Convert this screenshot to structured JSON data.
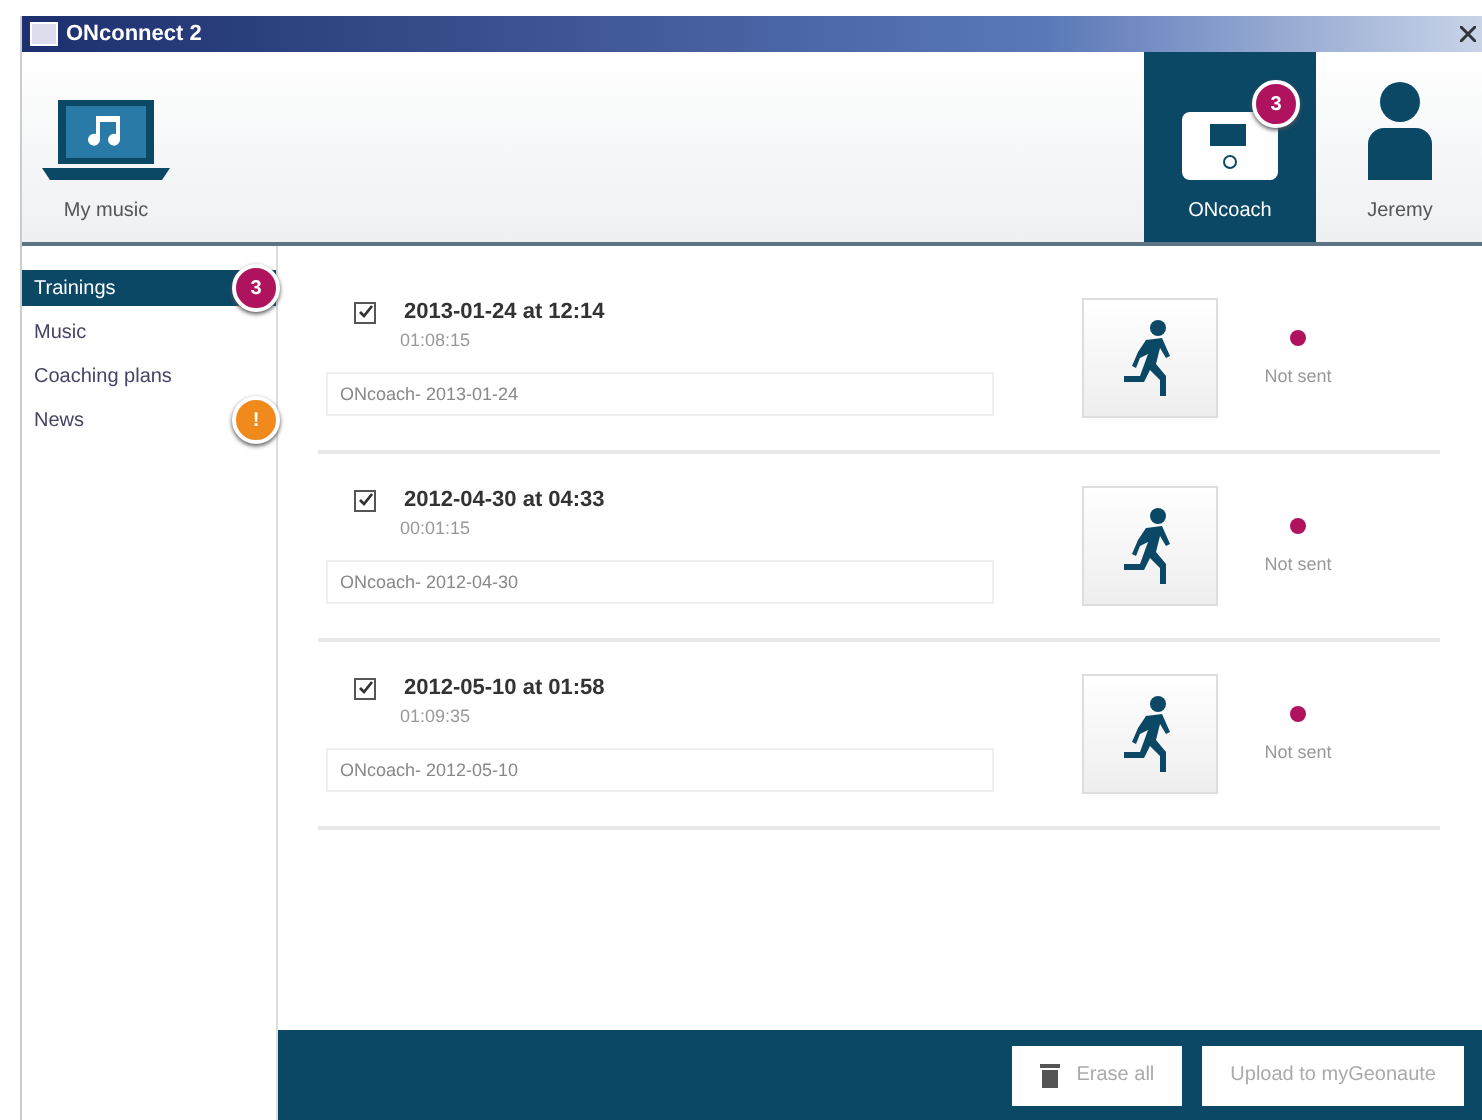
{
  "window": {
    "title": "ONconnect 2"
  },
  "header_tabs": [
    {
      "kind": "music",
      "label": "My music",
      "selected": false
    },
    {
      "kind": "device",
      "label": "ONcoach",
      "selected": true,
      "badge": "3"
    },
    {
      "kind": "user",
      "label": "Jeremy",
      "selected": false
    }
  ],
  "sidebar": {
    "items": [
      {
        "label": "Trainings",
        "selected": true,
        "badge": "3",
        "color": "#b0135e"
      },
      {
        "label": "Music",
        "selected": false
      },
      {
        "label": "Coaching plans",
        "selected": false
      },
      {
        "label": "News",
        "selected": false,
        "badge": "!",
        "color": "#f08a1c"
      }
    ]
  },
  "trainings": [
    {
      "checked": true,
      "title": "2013-01-24 at 12:14",
      "duration": "01:08:15",
      "name": "ONcoach- 2013-01-24",
      "status": "Not sent",
      "color": "#b0135e"
    },
    {
      "checked": true,
      "title": "2012-04-30 at 04:33",
      "duration": "00:01:15",
      "name": "ONcoach- 2012-04-30",
      "status": "Not sent",
      "color": "#b0135e"
    },
    {
      "checked": true,
      "title": "2012-05-10 at 01:58",
      "duration": "01:09:35",
      "name": "ONcoach- 2012-05-10",
      "status": "Not sent",
      "color": "#b0135e"
    }
  ],
  "footer": {
    "buttons": [
      {
        "kind": "erase",
        "label": "Erase all"
      },
      {
        "kind": "upload",
        "label": "Upload to myGeonaute"
      }
    ]
  }
}
